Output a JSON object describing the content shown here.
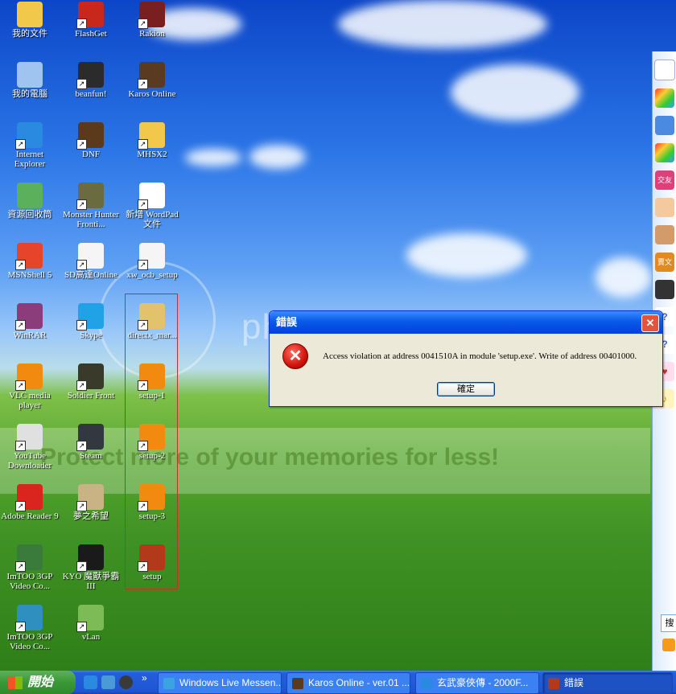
{
  "desktop": {
    "icons": [
      {
        "label": "我的文件",
        "icon": "folder-icon",
        "color": "#f2c84b"
      },
      {
        "label": "我的電腦",
        "icon": "computer-icon",
        "color": "#9fc4ef"
      },
      {
        "label": "Internet Explorer",
        "icon": "ie-icon",
        "color": "#2a8ae0"
      },
      {
        "label": "資源回收筒",
        "icon": "recycle-bin-icon",
        "color": "#5bb15b"
      },
      {
        "label": "MSNShell 5",
        "icon": "msnshell-icon",
        "color": "#e6452b"
      },
      {
        "label": "WinRAR",
        "icon": "winrar-icon",
        "color": "#8a3d7a"
      },
      {
        "label": "VLC media player",
        "icon": "vlc-icon",
        "color": "#f38a10"
      },
      {
        "label": "YouTube Downloader",
        "icon": "youtube-downloader-icon",
        "color": "#e0e0e0"
      },
      {
        "label": "Adobe Reader 9",
        "icon": "adobe-reader-icon",
        "color": "#d9251d"
      },
      {
        "label": "ImTOO 3GP Video Co...",
        "icon": "imtoo-icon",
        "color": "#3a7a3a"
      },
      {
        "label": "ImTOO 3GP Video Co...",
        "icon": "imtoo-icon",
        "color": "#2f8fbf"
      },
      {
        "label": "FlashGet",
        "icon": "flashget-icon",
        "color": "#c8281c"
      },
      {
        "label": "beanfun!",
        "icon": "beanfun-icon",
        "color": "#2b2b2b"
      },
      {
        "label": "DNF",
        "icon": "dnf-icon",
        "color": "#5a3a1a"
      },
      {
        "label": "Monster Hunter Fronti...",
        "icon": "monster-hunter-icon",
        "color": "#6b6b40"
      },
      {
        "label": "SD高達Online",
        "icon": "app-window-icon",
        "color": "#f5f5f5"
      },
      {
        "label": "Skype",
        "icon": "skype-icon",
        "color": "#22a2e6"
      },
      {
        "label": "Soldier Front",
        "icon": "soldier-front-icon",
        "color": "#3a3a2a"
      },
      {
        "label": "Steam",
        "icon": "steam-icon",
        "color": "#333840"
      },
      {
        "label": "夢之希望",
        "icon": "game-icon",
        "color": "#c9b284"
      },
      {
        "label": "KYO 魔獸爭霸III",
        "icon": "kyo-icon",
        "color": "#1a1a1a"
      },
      {
        "label": "vLan",
        "icon": "vlan-icon",
        "color": "#7cbb55"
      },
      {
        "label": "Rakion",
        "icon": "rakion-icon",
        "color": "#7a1f1f"
      },
      {
        "label": "Karos Online",
        "icon": "karos-icon",
        "color": "#5a3a20"
      },
      {
        "label": "MHSX2",
        "icon": "folder-icon",
        "color": "#f2c84b"
      },
      {
        "label": "新增 WordPad 文件",
        "icon": "wordpad-icon",
        "color": "#ffffff"
      },
      {
        "label": "xw_ocb_setup",
        "icon": "app-window-icon",
        "color": "#f5f5f5"
      },
      {
        "label": "directx_mar...",
        "icon": "directx-setup-icon",
        "color": "#e2c26a"
      },
      {
        "label": "setup-1",
        "icon": "vlc-icon",
        "color": "#f38a10"
      },
      {
        "label": "setup-2",
        "icon": "vlc-icon",
        "color": "#f38a10"
      },
      {
        "label": "setup-3",
        "icon": "vlc-icon",
        "color": "#f38a10"
      },
      {
        "label": "setup",
        "icon": "game-setup-icon",
        "color": "#b23a1a"
      }
    ]
  },
  "dialog": {
    "title": "錯誤",
    "message": "Access violation at address 0041510A in module 'setup.exe'. Write of address 00401000.",
    "ok_label": "確定",
    "close_glyph": "✕",
    "error_glyph": "✕"
  },
  "watermark": {
    "brand": "photobucket",
    "tagline": "Protect more of your memories for less!"
  },
  "sidebar": {
    "items": [
      {
        "label": "交友",
        "icon": "heart-icon",
        "color": "#e0407a"
      },
      {
        "label": "賣文",
        "icon": "tag-icon",
        "color": "#e08a20"
      },
      {
        "label": "搜",
        "icon": "search-icon",
        "color": "#ffffff"
      }
    ]
  },
  "taskbar": {
    "start_label": "開始",
    "quick_launch_more": "»",
    "buttons": [
      {
        "label": "Windows Live Messen...",
        "icon": "msn-messenger-icon",
        "color": "#3aa3e0",
        "active": false
      },
      {
        "label": "Karos Online - ver.01 ...",
        "icon": "karos-icon",
        "color": "#5a3a20",
        "active": false
      },
      {
        "label": "玄武豪俠傳 - 2000F...",
        "icon": "ie-icon",
        "color": "#2a8ae0",
        "active": false
      },
      {
        "label": "錯誤",
        "icon": "game-setup-icon",
        "color": "#b23a1a",
        "active": true
      }
    ]
  }
}
